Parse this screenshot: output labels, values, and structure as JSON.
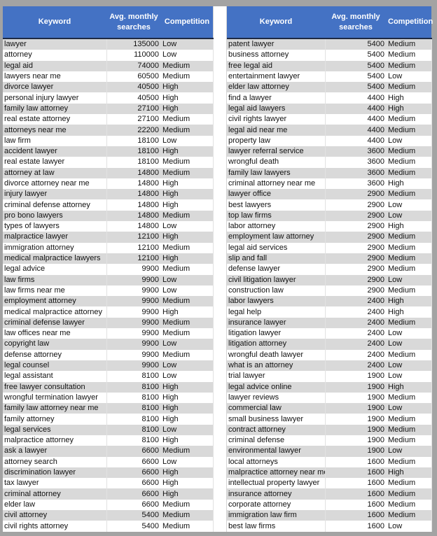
{
  "headers": {
    "keyword": "Keyword",
    "searches": "Avg. monthly searches",
    "competition": "Competition"
  },
  "colors": {
    "header_bg": "#4472c4",
    "band": "#d9d9d9",
    "background": "#a3a3a3"
  },
  "left_table": [
    [
      "lawyer",
      "135000",
      "Low"
    ],
    [
      "attorney",
      "110000",
      "Low"
    ],
    [
      "legal aid",
      "74000",
      "Medium"
    ],
    [
      "lawyers near me",
      "60500",
      "Medium"
    ],
    [
      "divorce lawyer",
      "40500",
      "High"
    ],
    [
      "personal injury lawyer",
      "40500",
      "High"
    ],
    [
      "family law attorney",
      "27100",
      "High"
    ],
    [
      "real estate attorney",
      "27100",
      "Medium"
    ],
    [
      "attorneys near me",
      "22200",
      "Medium"
    ],
    [
      "law firm",
      "18100",
      "Low"
    ],
    [
      "accident lawyer",
      "18100",
      "High"
    ],
    [
      "real estate lawyer",
      "18100",
      "Medium"
    ],
    [
      "attorney at law",
      "14800",
      "Medium"
    ],
    [
      "divorce attorney near me",
      "14800",
      "High"
    ],
    [
      "injury lawyer",
      "14800",
      "High"
    ],
    [
      "criminal defense attorney",
      "14800",
      "High"
    ],
    [
      "pro bono lawyers",
      "14800",
      "Medium"
    ],
    [
      "types of lawyers",
      "14800",
      "Low"
    ],
    [
      "malpractice lawyer",
      "12100",
      "High"
    ],
    [
      "immigration attorney",
      "12100",
      "Medium"
    ],
    [
      "medical malpractice lawyers",
      "12100",
      "High"
    ],
    [
      "legal advice",
      "9900",
      "Medium"
    ],
    [
      "law firms",
      "9900",
      "Low"
    ],
    [
      "law firms near me",
      "9900",
      "Low"
    ],
    [
      "employment attorney",
      "9900",
      "Medium"
    ],
    [
      "medical malpractice attorney",
      "9900",
      "High"
    ],
    [
      "criminal defense lawyer",
      "9900",
      "Medium"
    ],
    [
      "law offices near me",
      "9900",
      "Medium"
    ],
    [
      "copyright law",
      "9900",
      "Low"
    ],
    [
      "defense attorney",
      "9900",
      "Medium"
    ],
    [
      "legal counsel",
      "9900",
      "Low"
    ],
    [
      "legal assistant",
      "8100",
      "Low"
    ],
    [
      "free lawyer consultation",
      "8100",
      "High"
    ],
    [
      "wrongful termination lawyer",
      "8100",
      "High"
    ],
    [
      "family law attorney near me",
      "8100",
      "High"
    ],
    [
      "family attorney",
      "8100",
      "High"
    ],
    [
      "legal services",
      "8100",
      "Low"
    ],
    [
      "malpractice attorney",
      "8100",
      "High"
    ],
    [
      "ask a lawyer",
      "6600",
      "Medium"
    ],
    [
      "attorney search",
      "6600",
      "Low"
    ],
    [
      "discrimination lawyer",
      "6600",
      "High"
    ],
    [
      "tax lawyer",
      "6600",
      "High"
    ],
    [
      "criminal attorney",
      "6600",
      "High"
    ],
    [
      "elder law",
      "6600",
      "Medium"
    ],
    [
      "civil attorney",
      "5400",
      "Medium"
    ],
    [
      "civil rights attorney",
      "5400",
      "Medium"
    ]
  ],
  "right_table": [
    [
      "patent lawyer",
      "5400",
      "Medium"
    ],
    [
      "business attorney",
      "5400",
      "Medium"
    ],
    [
      "free legal aid",
      "5400",
      "Medium"
    ],
    [
      "entertainment lawyer",
      "5400",
      "Low"
    ],
    [
      "elder law attorney",
      "5400",
      "Medium"
    ],
    [
      "find a lawyer",
      "4400",
      "High"
    ],
    [
      "legal aid lawyers",
      "4400",
      "High"
    ],
    [
      "civil rights lawyer",
      "4400",
      "Medium"
    ],
    [
      "legal aid near me",
      "4400",
      "Medium"
    ],
    [
      "property law",
      "4400",
      "Low"
    ],
    [
      "lawyer referral service",
      "3600",
      "Medium"
    ],
    [
      "wrongful death",
      "3600",
      "Medium"
    ],
    [
      "family law lawyers",
      "3600",
      "Medium"
    ],
    [
      "criminal attorney near me",
      "3600",
      "High"
    ],
    [
      "lawyer office",
      "2900",
      "Medium"
    ],
    [
      "best lawyers",
      "2900",
      "Low"
    ],
    [
      "top law firms",
      "2900",
      "Low"
    ],
    [
      "labor attorney",
      "2900",
      "High"
    ],
    [
      "employment law attorney",
      "2900",
      "Medium"
    ],
    [
      "legal aid services",
      "2900",
      "Medium"
    ],
    [
      "slip and fall",
      "2900",
      "Medium"
    ],
    [
      "defense lawyer",
      "2900",
      "Medium"
    ],
    [
      "civil litigation lawyer",
      "2900",
      "Low"
    ],
    [
      "construction law",
      "2900",
      "Medium"
    ],
    [
      "labor lawyers",
      "2400",
      "High"
    ],
    [
      "legal help",
      "2400",
      "High"
    ],
    [
      "insurance lawyer",
      "2400",
      "Medium"
    ],
    [
      "litigation lawyer",
      "2400",
      "Low"
    ],
    [
      "litigation attorney",
      "2400",
      "Low"
    ],
    [
      "wrongful death lawyer",
      "2400",
      "Medium"
    ],
    [
      "what is an attorney",
      "2400",
      "Low"
    ],
    [
      "trial lawyer",
      "1900",
      "Low"
    ],
    [
      "legal advice online",
      "1900",
      "High"
    ],
    [
      "lawyer reviews",
      "1900",
      "Medium"
    ],
    [
      "commercial law",
      "1900",
      "Low"
    ],
    [
      "small business lawyer",
      "1900",
      "Medium"
    ],
    [
      "contract attorney",
      "1900",
      "Medium"
    ],
    [
      "criminal defense",
      "1900",
      "Medium"
    ],
    [
      "environmental lawyer",
      "1900",
      "Low"
    ],
    [
      "local attorneys",
      "1600",
      "Medium"
    ],
    [
      "malpractice attorney near me",
      "1600",
      "High"
    ],
    [
      "intellectual property lawyer",
      "1600",
      "Medium"
    ],
    [
      "insurance attorney",
      "1600",
      "Medium"
    ],
    [
      "corporate attorney",
      "1600",
      "Medium"
    ],
    [
      "immigration law firm",
      "1600",
      "Medium"
    ],
    [
      "best law firms",
      "1600",
      "Low"
    ]
  ]
}
